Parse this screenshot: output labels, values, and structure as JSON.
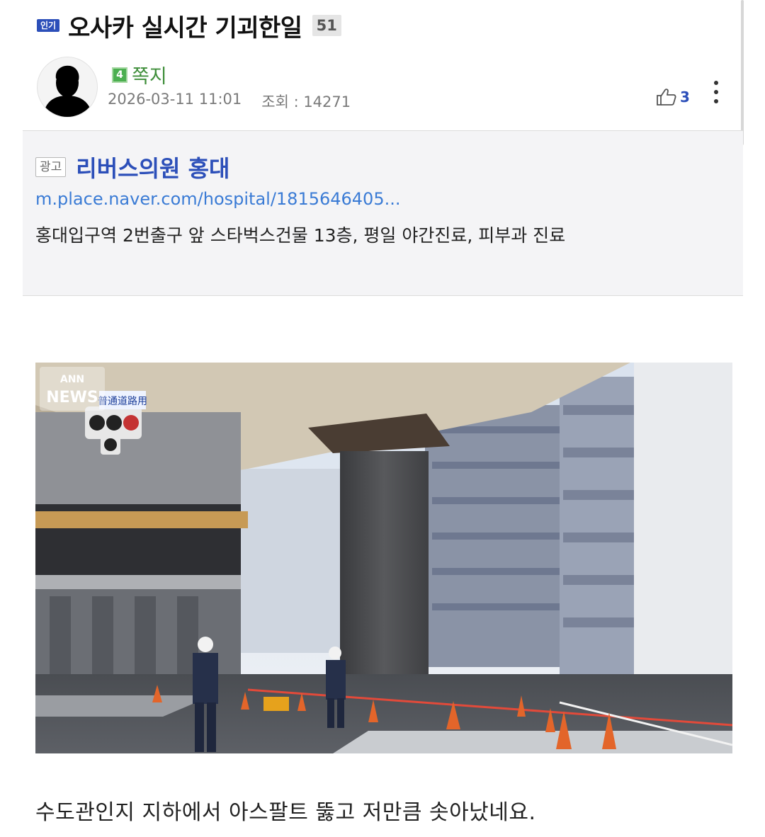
{
  "post": {
    "badge": "인기",
    "title": "오사카 실시간 기괴한일",
    "comment_count": "51"
  },
  "author": {
    "level": "4",
    "name": "쪽지",
    "date": "2026-03-11 11:01",
    "views": "조회 : 14271",
    "likes": "3"
  },
  "ad": {
    "label": "광고",
    "title": "리버스의원 홍대",
    "url": "m.place.naver.com/hospital/1815646405...",
    "description": "홍대입구역 2번출구 앞 스타벅스건물 13층, 평일 야간진료, 피부과 진료"
  },
  "photo": {
    "logo_top": "ANN",
    "logo_bottom": "NEWS",
    "sign_text": "普通道路用"
  },
  "body": {
    "caption": "수도관인지 지하에서 아스팔트 뚫고 저만큼 솟아났네요."
  },
  "icons": {
    "like": "thumbs-up-icon",
    "more": "more-vertical-icon",
    "avatar": "avatar-silhouette"
  },
  "colors": {
    "accent": "#2c4fb9",
    "author": "#3f8e3a",
    "link": "#3a7bd5"
  }
}
